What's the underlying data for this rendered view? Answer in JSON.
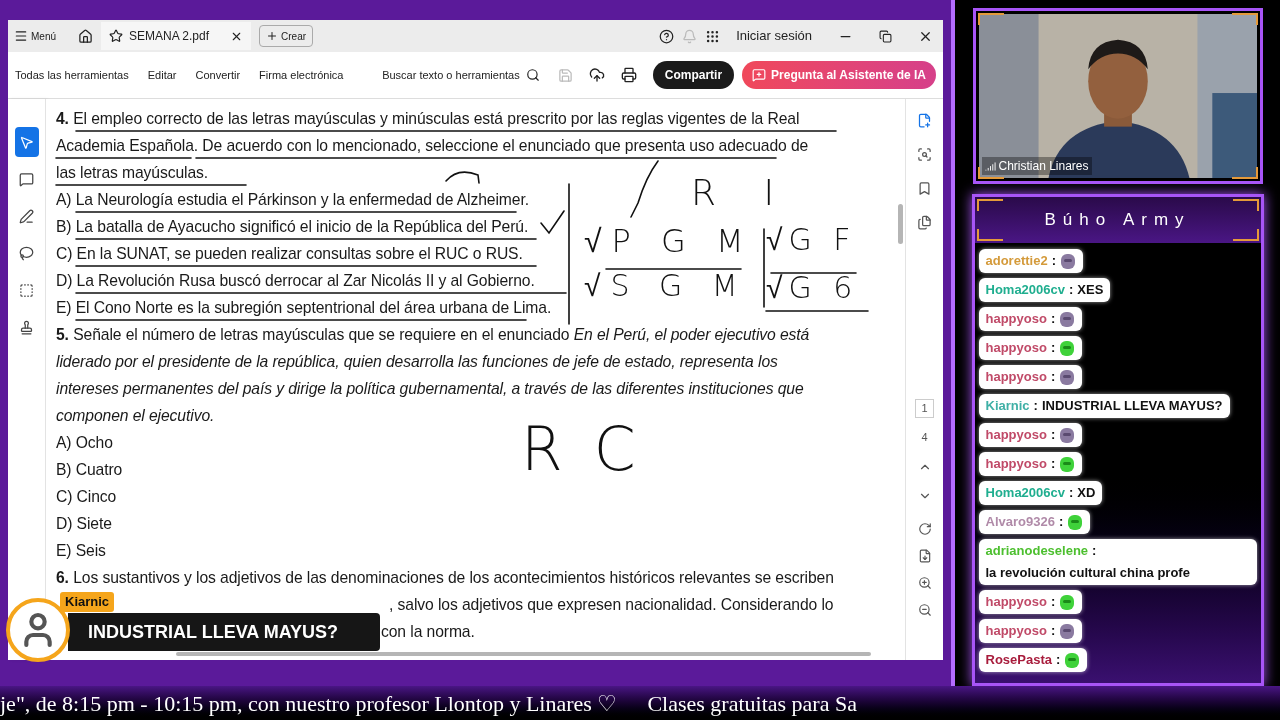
{
  "viewer": {
    "menu_label": "Menú",
    "tab_title": "SEMANA 2.pdf",
    "new_button": "Crear",
    "sign_in": "Iniciar sesión",
    "toolbar": [
      "Todas las herramientas",
      "Editar",
      "Convertir",
      "Firma electrónica"
    ],
    "search_placeholder": "Buscar texto o herramientas",
    "share_button": "Compartir",
    "ai_button": "Pregunta al Asistente de IA",
    "tools": [
      {
        "kind": "select",
        "selected": true
      },
      {
        "kind": "comment",
        "selected": false
      },
      {
        "kind": "pen",
        "selected": false
      },
      {
        "kind": "lasso",
        "selected": false
      },
      {
        "kind": "text",
        "selected": false
      },
      {
        "kind": "stamp",
        "selected": false
      }
    ],
    "page_number": "1",
    "page_count": "4"
  },
  "document": {
    "q4": "**4.** El empleo correcto de las letras mayúsculas y minúsculas está prescrito por las reglas vigentes de la Real Academia Española. De acuerdo con lo mencionado, seleccione el enunciado que presenta uso adecuado de las letras mayúsculas.",
    "q4_options": [
      "A) La Neurología estudia el Párkinson y la enfermedad de Alzheimer.",
      "B) La batalla de Ayacucho significó el inicio de la República del Perú.",
      "C) En la SUNAT, se pueden realizar consultas sobre el RUC o RUS.",
      "D) La Revolución Rusa buscó derrocar al Zar Nicolás II y al Gobierno.",
      "E) El Cono Norte es la subregión septentrional del área urbana de Lima."
    ],
    "q5": "**5.** Señale el número de letras mayúsculas que se requiere en el enunciado *En el Perú, el poder ejecutivo está liderado por el presidente de la república, quien desarrolla las funciones de jefe de estado, representa los intereses permanentes del país y dirige la política gubernamental, a través de las diferentes instituciones que componen el ejecutivo.*",
    "q5_options": [
      "A) Ocho",
      "B) Cuatro",
      "C) Cinco",
      "D) Siete",
      "E) Seis"
    ],
    "q6_lines": [
      "**6.** Los sustantivos y los adjetivos de las denominaciones de los acontecimientos históricos relevantes se escriben",
      ", salvo los adjetivos que expresen nacionalidad. Considerando lo",
      "con la norma."
    ],
    "handwriting": [
      "R  I",
      "√P G M",
      "√S G M",
      "√G F",
      "√G 6",
      "R C"
    ]
  },
  "toast": {
    "user": "Kiarnic",
    "message": "INDUSTRIAL LLEVA MAYUS?"
  },
  "webcam": {
    "name": "Christian Linares"
  },
  "chat": {
    "title": "Búho Army",
    "messages": [
      {
        "user": "adorettie2",
        "separator": ":",
        "color": "#d49a3a",
        "kind": "emote"
      },
      {
        "user": "Homa2006cv",
        "separator": ":",
        "color": "#1fae8f",
        "kind": "text",
        "text": "XES"
      },
      {
        "user": "happyoso",
        "separator": ":",
        "color": "#c04a68",
        "kind": "emote"
      },
      {
        "user": "happyoso",
        "separator": ":",
        "color": "#c04a68",
        "kind": "emote"
      },
      {
        "user": "happyoso",
        "separator": ":",
        "color": "#c04a68",
        "kind": "emote"
      },
      {
        "user": "Kiarnic",
        "separator": ":",
        "color": "#3fb0a6",
        "kind": "text",
        "text": "INDUSTRIAL LLEVA MAYUS?"
      },
      {
        "user": "happyoso",
        "separator": ":",
        "color": "#c04a68",
        "kind": "emote"
      },
      {
        "user": "happyoso",
        "separator": ":",
        "color": "#c04a68",
        "kind": "emote"
      },
      {
        "user": "Homa2006cv",
        "separator": ":",
        "color": "#1fae8f",
        "kind": "text",
        "text": "XD"
      },
      {
        "user": "Alvaro9326",
        "separator": ":",
        "color": "#b08aa8",
        "kind": "emote"
      },
      {
        "user": "adrianodeselene",
        "separator": ":",
        "color": "#4cbf2e",
        "kind": "text",
        "text": "la revolución cultural china profe"
      },
      {
        "user": "happyoso",
        "separator": ":",
        "color": "#c04a68",
        "kind": "emote"
      },
      {
        "user": "happyoso",
        "separator": ":",
        "color": "#c04a68",
        "kind": "emote"
      },
      {
        "user": "RosePasta",
        "separator": ":",
        "color": "#a81c3c",
        "kind": "emote"
      }
    ]
  },
  "ticker": [
    "je\", de 8:15 pm - 10:15 pm, con nuestro profesor Llontop y Linares ♡",
    "Clases gratuitas para Sa"
  ]
}
